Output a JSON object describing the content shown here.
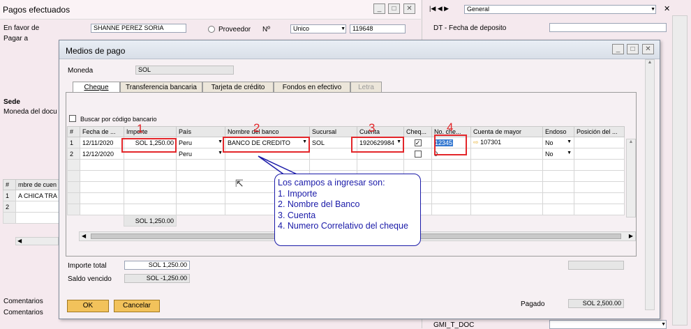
{
  "background_window": {
    "title": "Pagos efectuados",
    "en_favor_de_label": "En favor de",
    "en_favor_de_value": "SHANNE PEREZ SORIA",
    "pagar_a_label": "Pagar a",
    "proveedor_label": "Proveedor",
    "no_label": "Nº",
    "series_value": "Unico",
    "doc_number": "119648",
    "sede_label": "Sede",
    "moneda_doc_label": "Moneda del docu",
    "left_table": {
      "headers": [
        "#",
        "mbre de cuen"
      ],
      "rows": [
        [
          "1",
          "A CHICA TRA"
        ],
        [
          "2",
          ""
        ]
      ]
    },
    "comentarios_label_1": "Comentarios",
    "comentarios_label_2": "Comentarios"
  },
  "right_panel": {
    "nav_select": "General",
    "dt_fecha_label": "DT - Fecha de deposito",
    "gmi_label": "GMI_T_DOC"
  },
  "dialog": {
    "title": "Medios de pago",
    "moneda_label": "Moneda",
    "moneda_value": "SOL",
    "tabs": [
      "Cheque",
      "Transferencia bancaria",
      "Tarjeta de crédito",
      "Fondos en efectivo",
      "Letra"
    ],
    "buscar_label": "Buscar por código bancario",
    "grid": {
      "headers": [
        "#",
        "Fecha de ...",
        "Importe",
        "País",
        "Nombre del banco",
        "Sucursal",
        "Cuenta",
        "Cheq...",
        "No. che...",
        "Cuenta de mayor",
        "Endoso",
        "Posición del ..."
      ],
      "rows": [
        {
          "n": "1",
          "fecha": "12/11/2020",
          "importe": "SOL 1,250.00",
          "pais": "Peru",
          "banco": "BANCO DE CREDITO",
          "sucursal": "SOL",
          "cuenta": "1920629984",
          "cheq": "✓",
          "no_cheque": "12345",
          "cuenta_mayor": "107301",
          "endoso": "No"
        },
        {
          "n": "2",
          "fecha": "12/12/2020",
          "importe": "",
          "pais": "Peru",
          "banco": "",
          "sucursal": "",
          "cuenta": "",
          "cheq": "",
          "no_cheque": "0",
          "cuenta_mayor": "",
          "endoso": "No"
        }
      ],
      "total": "SOL 1,250.00"
    },
    "importe_total_label": "Importe total",
    "importe_total_value": "SOL 1,250.00",
    "saldo_vencido_label": "Saldo vencido",
    "saldo_vencido_value": "SOL -1,250.00",
    "pagado_label": "Pagado",
    "pagado_value": "SOL 2,500.00",
    "ok_label": "OK",
    "cancel_label": "Cancelar"
  },
  "annotation": {
    "markers": [
      "1",
      "2",
      "3",
      "4"
    ],
    "callout_title": "Los campos a ingresar son:",
    "callout_items": [
      "1. Importe",
      "2. Nombre del Banco",
      "3. Cuenta",
      "4. Numero Correlativo del cheque"
    ],
    "marker_color": "#e3262a",
    "callout_color": "#1a1aa8"
  }
}
